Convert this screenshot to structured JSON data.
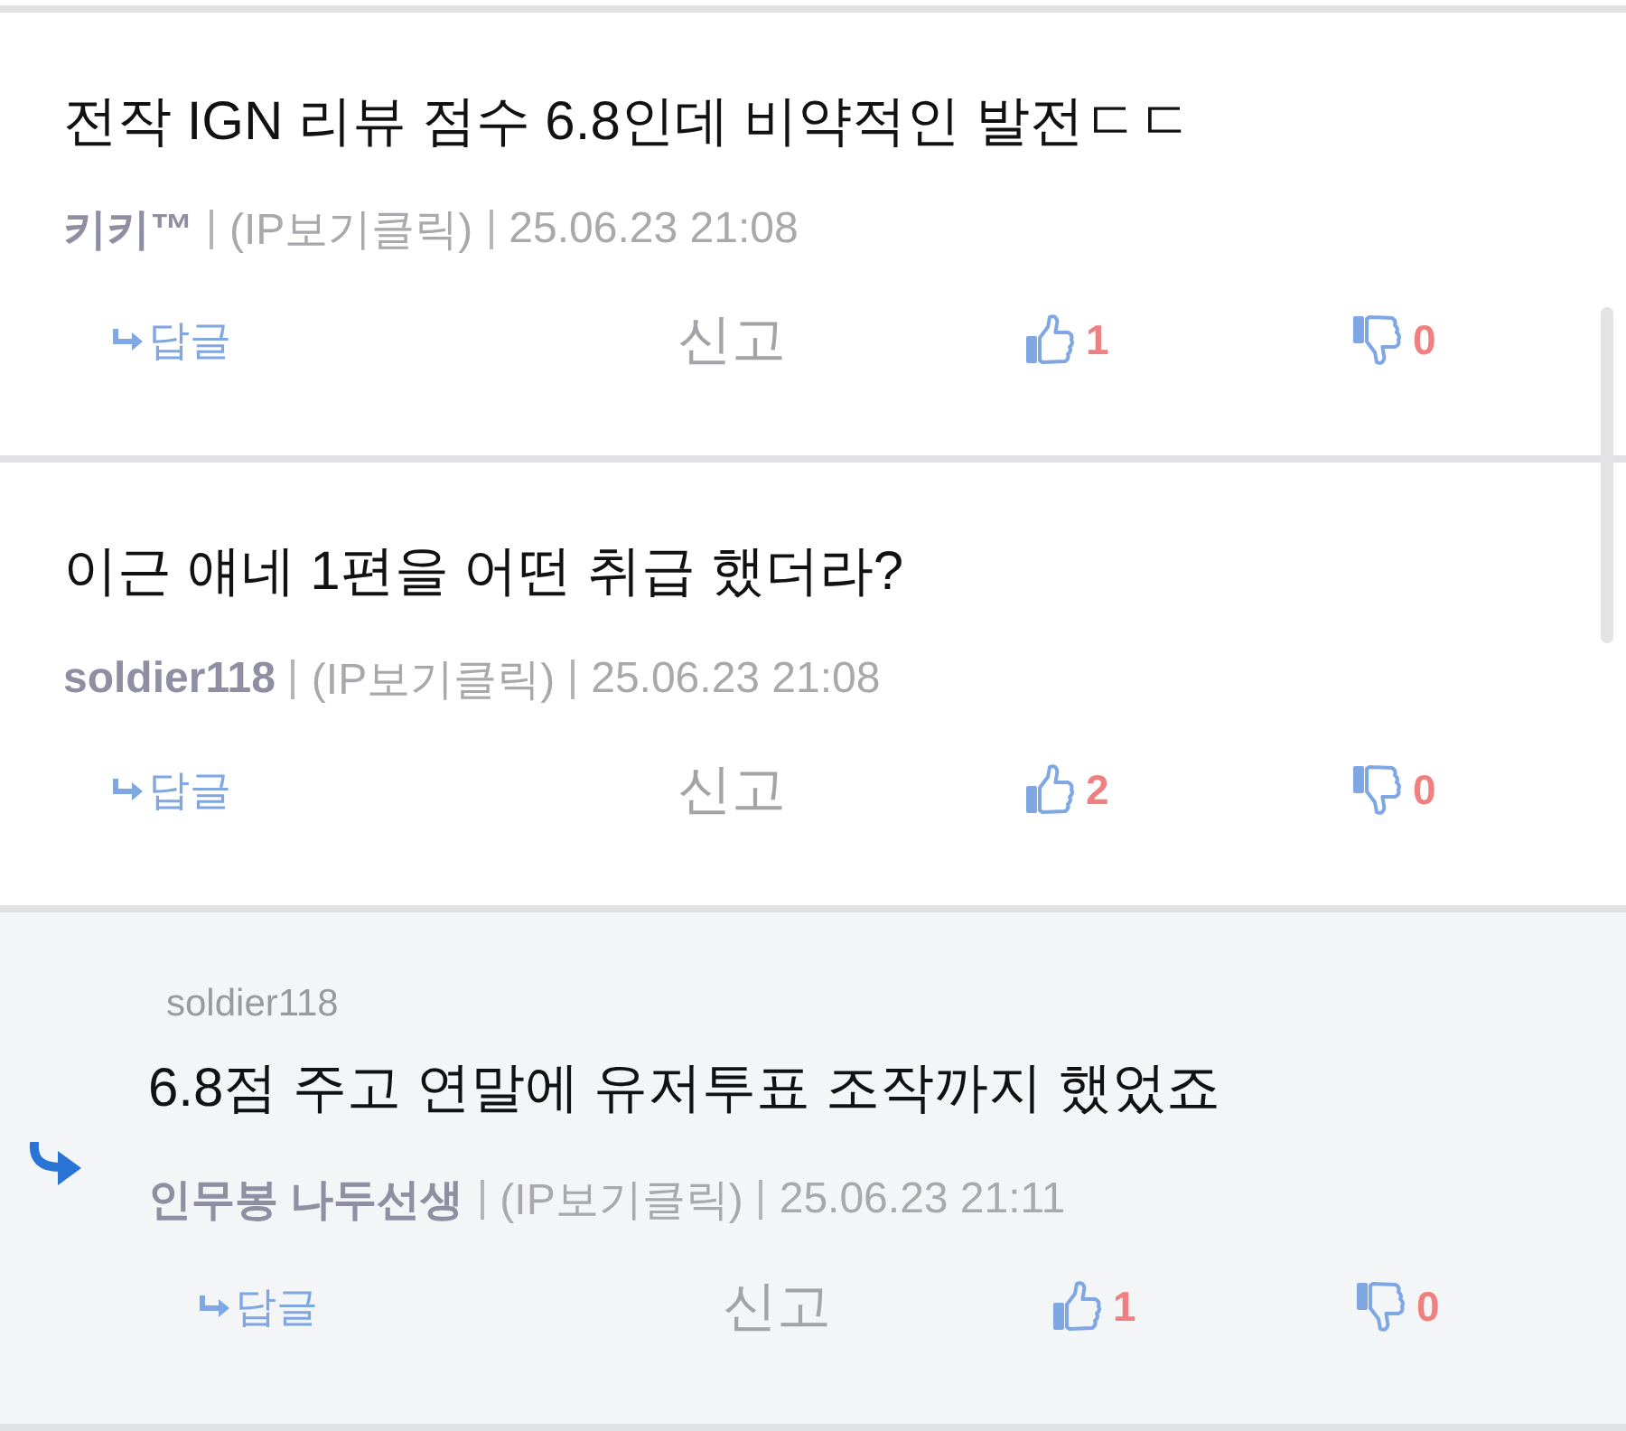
{
  "comments": [
    {
      "kind": "comment",
      "text": "전작 IGN 리뷰 점수 6.8인데 비약적인 발전ㄷㄷ",
      "author": "키키™",
      "ip_link": "(IP보기클릭)",
      "date": "25.06.23 21:08",
      "reply_label": "답글",
      "report_label": "신고",
      "likes": "1",
      "dislikes": "0"
    },
    {
      "kind": "comment",
      "text": "이근 얘네 1편을 어떤 취급 했더라?",
      "author": "soldier118",
      "ip_link": "(IP보기클릭)",
      "date": "25.06.23 21:08",
      "reply_label": "답글",
      "report_label": "신고",
      "likes": "2",
      "dislikes": "0"
    },
    {
      "kind": "reply",
      "reply_to": "soldier118",
      "text": "6.8점 주고 연말에 유저투표 조작까지 했었죠",
      "author": "인무봉 나두선생",
      "ip_link": "(IP보기클릭)",
      "date": "25.06.23 21:11",
      "reply_label": "답글",
      "report_label": "신고",
      "likes": "1",
      "dislikes": "0"
    }
  ]
}
